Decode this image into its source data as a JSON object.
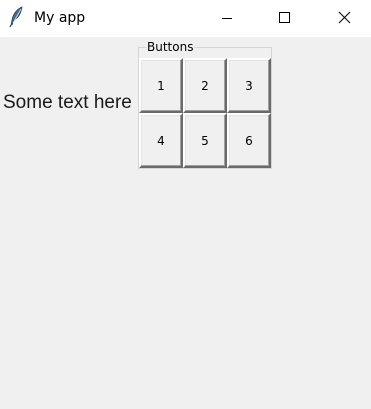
{
  "window": {
    "title": "My app",
    "app_icon": "feather-icon",
    "controls": [
      "minimize-icon",
      "maximize-icon",
      "close-icon"
    ]
  },
  "content": {
    "label": "Some text here",
    "frame": {
      "caption": "Buttons",
      "buttons": [
        "1",
        "2",
        "3",
        "4",
        "5",
        "6"
      ]
    }
  }
}
